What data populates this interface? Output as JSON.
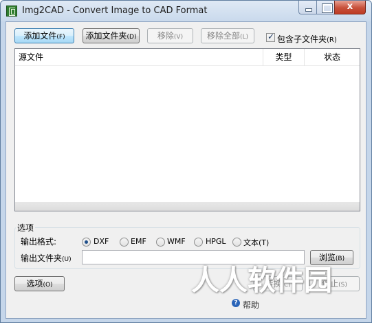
{
  "window": {
    "title": "Img2CAD - Convert Image to CAD Format",
    "close_glyph": "x"
  },
  "toolbar": {
    "add_file": "添加文件",
    "add_file_hotkey": "(F)",
    "add_folder": "添加文件夹",
    "add_folder_hotkey": "(D)",
    "remove": "移除",
    "remove_hotkey": "(V)",
    "remove_all": "移除全部",
    "remove_all_hotkey": "(L)",
    "include_subfolders": "包含子文件夹",
    "include_subfolders_hotkey": "(R)",
    "include_subfolders_checked": true
  },
  "file_list": {
    "columns": [
      "源文件",
      "类型",
      "状态"
    ],
    "rows": []
  },
  "options": {
    "group_title": "选项",
    "format_label": "输出格式:",
    "formats": [
      {
        "label": "DXF",
        "selected": true
      },
      {
        "label": "EMF",
        "selected": false
      },
      {
        "label": "WMF",
        "selected": false
      },
      {
        "label": "HPGL",
        "selected": false
      },
      {
        "label": "文本",
        "hotkey": "(T)",
        "selected": false
      }
    ],
    "output_folder_label": "输出文件夹",
    "output_folder_hotkey": "(U)",
    "output_folder_value": "",
    "browse": "浏览",
    "browse_hotkey": "(B)"
  },
  "footer": {
    "options_button": "选项",
    "options_hotkey": "(O)",
    "convert": "转换",
    "convert_hotkey": "(C)",
    "stop": "停止",
    "stop_hotkey": "(S)",
    "help_text": "帮助"
  },
  "watermark": {
    "text": "人人软件园"
  }
}
